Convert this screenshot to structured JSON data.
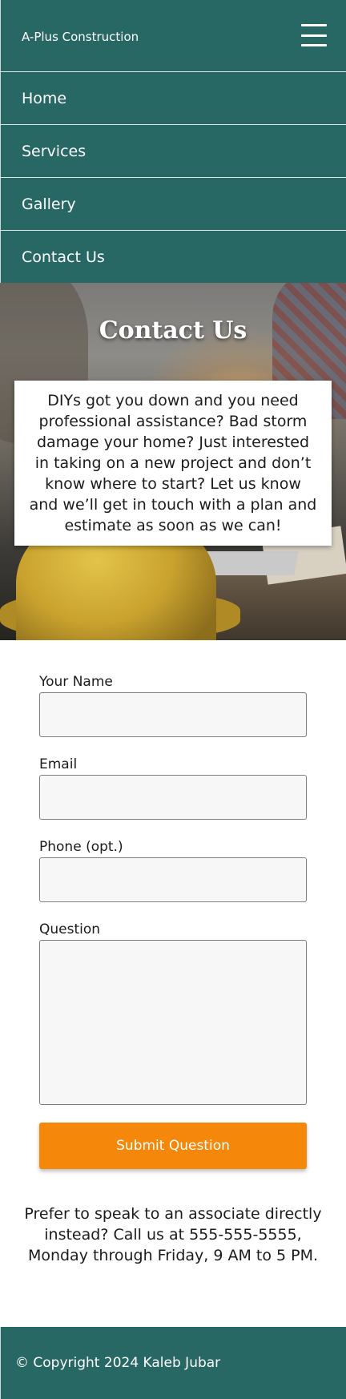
{
  "header": {
    "brand": "A-Plus Construction",
    "menu_icon": "hamburger-menu-icon"
  },
  "nav": {
    "items": [
      {
        "label": "Home"
      },
      {
        "label": "Services"
      },
      {
        "label": "Gallery"
      },
      {
        "label": "Contact Us"
      }
    ]
  },
  "hero": {
    "title": "Contact Us",
    "body": "DIYs got you down and you need professional assistance? Bad storm damage your home? Just interested in taking on a new project and don’t know where to start? Let us know and we’ll get in touch with a plan and estimate as soon as we can!"
  },
  "form": {
    "name_label": "Your Name",
    "name_value": "",
    "email_label": "Email",
    "email_value": "",
    "phone_label": "Phone (opt.)",
    "phone_value": "",
    "question_label": "Question",
    "question_value": "",
    "submit_label": "Submit Question"
  },
  "contact": {
    "text": "Prefer to speak to an associate directly instead? Call us at 555-555-5555, Monday through Friday, 9 AM to 5 PM."
  },
  "footer": {
    "copyright": "© Copyright 2024 Kaleb Jubar"
  },
  "colors": {
    "primary": "#276864",
    "accent": "#f5880b",
    "field_bg": "#f7f7f7"
  }
}
